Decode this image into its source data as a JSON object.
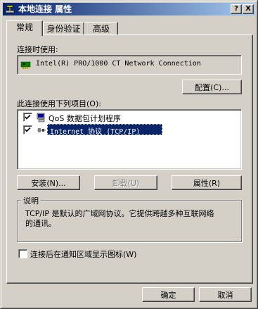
{
  "window": {
    "title": "本地连接 属性",
    "help_button": "?",
    "close_button": "X"
  },
  "tabs": [
    {
      "label": "常规",
      "active": true
    },
    {
      "label": "身份验证",
      "active": false
    },
    {
      "label": "高级",
      "active": false
    }
  ],
  "general": {
    "connect_using_label": "连接时使用:",
    "adapter_name": "Intel(R) PRO/1000 CT Network Connection",
    "configure_button": "配置(C)...",
    "items_label": "此连接使用下列项目(O):",
    "items": [
      {
        "label": "QoS 数据包计划程序",
        "checked": true,
        "icon": "qos-icon"
      },
      {
        "label": "Internet 协议 (TCP/IP)",
        "checked": true,
        "selected": true,
        "icon": "protocol-icon"
      }
    ],
    "install_button": "安装(N)...",
    "uninstall_button": "卸载(U)",
    "properties_button": "属性(R)",
    "description_title": "说明",
    "description_text_line1": "TCP/IP 是默认的广域网协议。它提供跨越多种互联网络",
    "description_text_line2": "的通讯。",
    "notify_checkbox_label": "连接后在通知区域显示图标(W)",
    "notify_checked": false
  },
  "footer": {
    "ok_button": "确定",
    "cancel_button": "取消"
  },
  "colors": {
    "selection": "#0a246a",
    "face": "#d4d0c8"
  }
}
